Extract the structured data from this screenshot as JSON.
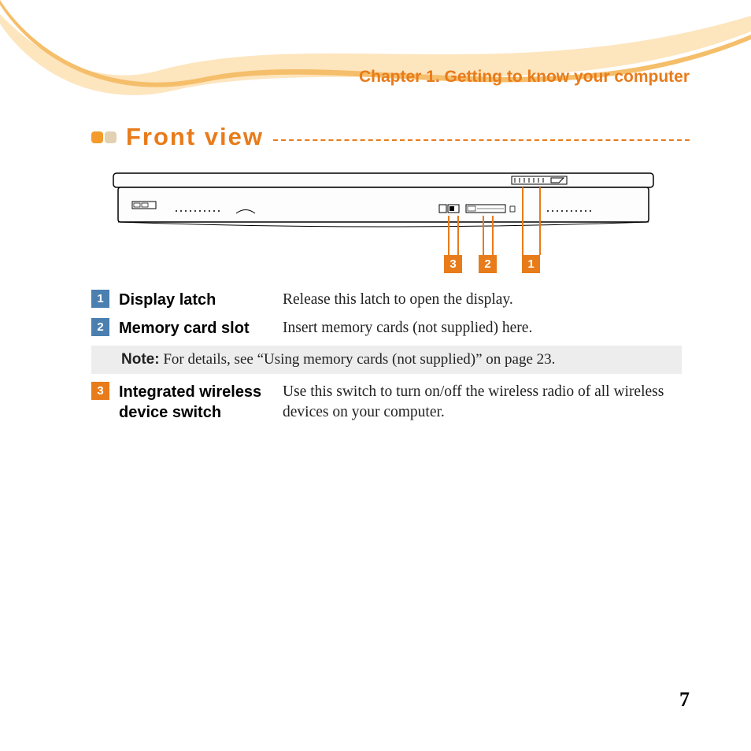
{
  "chapter": "Chapter 1. Getting to know your computer",
  "section_title": "Front view",
  "callouts": {
    "c1": "1",
    "c2": "2",
    "c3": "3"
  },
  "items": [
    {
      "num": "1",
      "term": "Display latch",
      "desc": "Release this latch to open the display."
    },
    {
      "num": "2",
      "term": "Memory card slot",
      "desc": "Insert memory cards (not supplied) here."
    },
    {
      "num": "3",
      "term": "Integrated wireless device switch",
      "desc": "Use this switch to turn on/off the wireless radio of all wireless devices on your computer."
    }
  ],
  "note_label": "Note:",
  "note_text": " For details, see “Using memory cards (not supplied)” on page 23.",
  "page_number": "7"
}
